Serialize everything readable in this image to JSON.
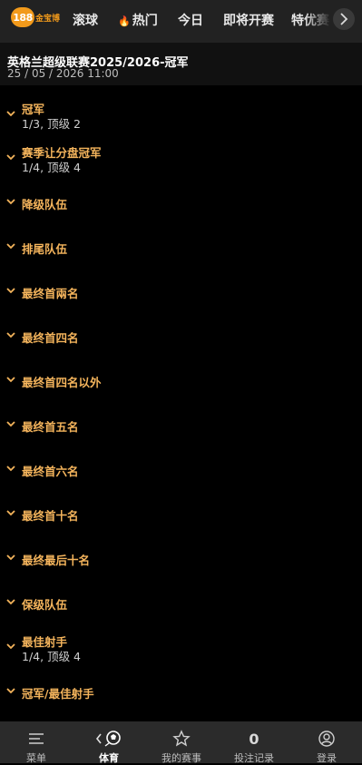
{
  "brand": {
    "badge": "188",
    "name": "金宝博"
  },
  "nav": {
    "items": [
      "滚球",
      "热门",
      "今日",
      "即将开赛",
      "特优赛"
    ]
  },
  "event": {
    "title": "英格兰超级联赛2025/2026-冠军",
    "date": "25 / 05 / 2026 11:00"
  },
  "markets": [
    {
      "name": "冠军",
      "sub": "1/3, 顶级 2"
    },
    {
      "name": "赛季让分盘冠军",
      "sub": "1/4, 顶级 4"
    },
    {
      "name": "降级队伍",
      "sub": ""
    },
    {
      "name": "排尾队伍",
      "sub": ""
    },
    {
      "name": "最终首兩名",
      "sub": ""
    },
    {
      "name": "最终首四名",
      "sub": ""
    },
    {
      "name": "最终首四名以外",
      "sub": ""
    },
    {
      "name": "最终首五名",
      "sub": ""
    },
    {
      "name": "最终首六名",
      "sub": ""
    },
    {
      "name": "最终首十名",
      "sub": ""
    },
    {
      "name": "最终最后十名",
      "sub": ""
    },
    {
      "name": "保级队伍",
      "sub": ""
    },
    {
      "name": "最佳射手",
      "sub": "1/4, 顶级 4"
    },
    {
      "name": "冠军/最佳射手",
      "sub": ""
    }
  ],
  "bottom": {
    "menu": "菜单",
    "sports": "体育",
    "my_events": "我的赛事",
    "bet_count": "0",
    "bet_record": "投注记录",
    "login": "登录"
  },
  "colors": {
    "accent": "#f4b45c",
    "brand": "#f29a1b"
  }
}
